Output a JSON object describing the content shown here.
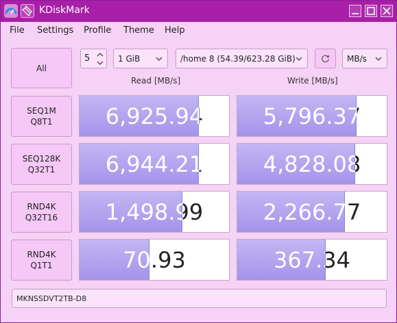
{
  "window": {
    "title": "KDiskMark"
  },
  "menu": [
    "File",
    "Settings",
    "Profile",
    "Theme",
    "Help"
  ],
  "controls": {
    "all_label": "All",
    "runs": "5",
    "size": "1 GiB",
    "path": "/home 8 (54.39/623.28 GiB)",
    "unit": "MB/s"
  },
  "headers": {
    "read": "Read [MB/s]",
    "write": "Write [MB/s]"
  },
  "tests": [
    {
      "line1": "SEQ1M",
      "line2": "Q8T1",
      "read": "6,925.94",
      "read_fill": 0.8,
      "write": "5,796.37",
      "write_fill": 0.8
    },
    {
      "line1": "SEQ128K",
      "line2": "Q32T1",
      "read": "6,944.21",
      "read_fill": 0.8,
      "write": "4,828.08",
      "write_fill": 0.79
    },
    {
      "line1": "RND4K",
      "line2": "Q32T16",
      "read": "1,498.99",
      "read_fill": 0.69,
      "write": "2,266.77",
      "write_fill": 0.72
    },
    {
      "line1": "RND4K",
      "line2": "Q1T1",
      "read": "70.93",
      "read_fill": 0.47,
      "write": "367.34",
      "write_fill": 0.59
    }
  ],
  "device": "MKNSSDVT2TB-D8",
  "colors": {
    "titlebar": "#a81fa8",
    "background": "#f6d2f6",
    "bar_fill": "#a593ea"
  }
}
